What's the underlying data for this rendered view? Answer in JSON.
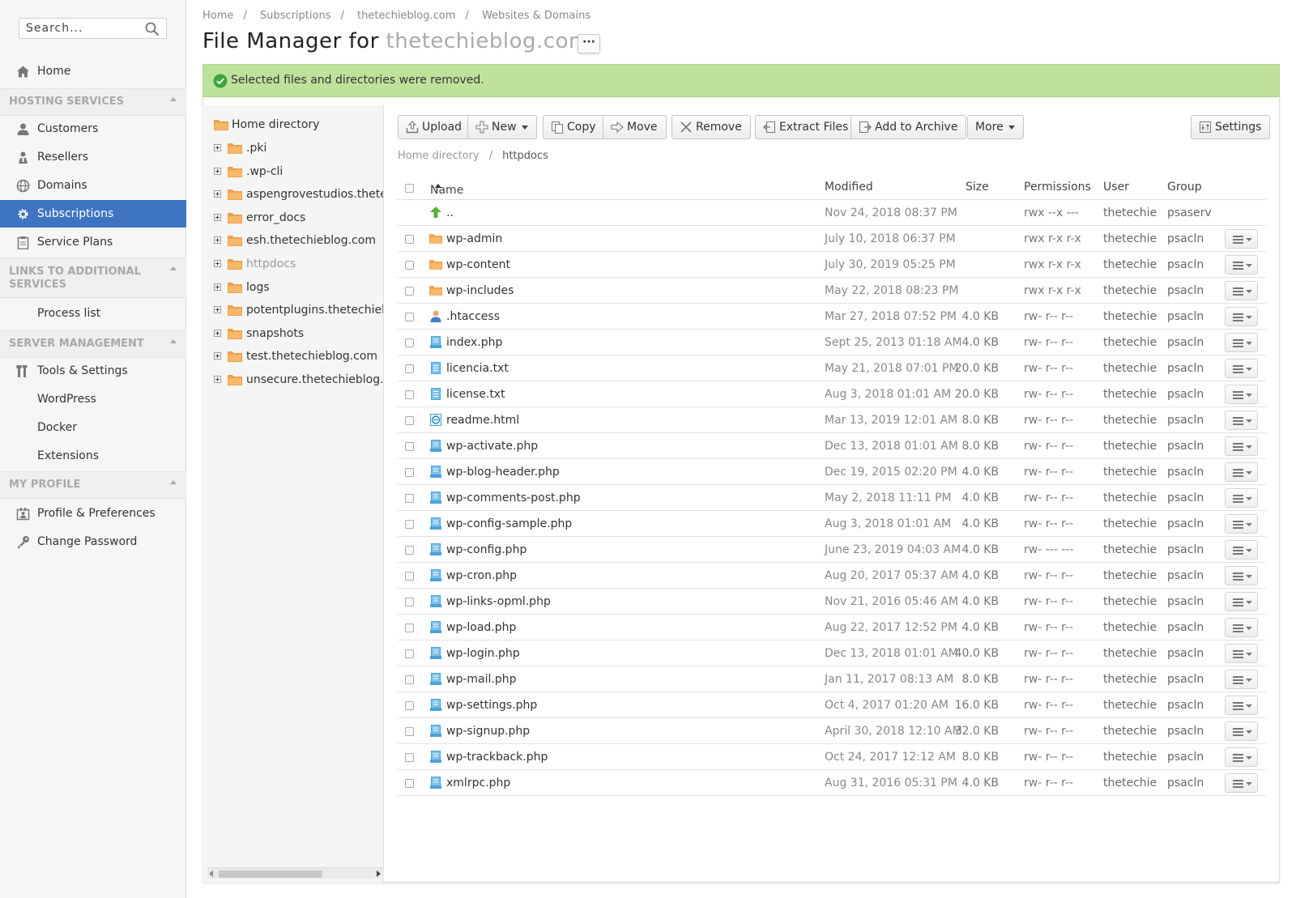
{
  "sidebar": {
    "search": {
      "placeholder": "Search..."
    },
    "home": "Home",
    "sections": [
      {
        "title": "HOSTING SERVICES",
        "items": [
          "Customers",
          "Resellers",
          "Domains",
          "Subscriptions",
          "Service Plans"
        ]
      },
      {
        "title": "LINKS TO ADDITIONAL SERVICES",
        "items": [
          "Process list"
        ]
      },
      {
        "title": "SERVER MANAGEMENT",
        "items": [
          "Tools & Settings",
          "WordPress",
          "Docker",
          "Extensions"
        ]
      },
      {
        "title": "MY PROFILE",
        "items": [
          "Profile & Preferences",
          "Change Password"
        ]
      }
    ],
    "active_item": "Subscriptions",
    "accent_color": "#3f74c2"
  },
  "breadcrumb": [
    "Home",
    "Subscriptions",
    "thetechieblog.com",
    "Websites & Domains"
  ],
  "title": {
    "prefix": "File Manager for",
    "domain": "thetechieblog.com",
    "more_label": "···"
  },
  "alert": {
    "message": "Selected files and directories were removed.",
    "color": "#bfe29a"
  },
  "tree": {
    "root": "Home directory",
    "items": [
      ".pki",
      ".wp-cli",
      "aspengrovestudios.thetechieblog.com",
      "error_docs",
      "esh.thetechieblog.com",
      "httpdocs",
      "logs",
      "potentplugins.thetechieblog.com",
      "snapshots",
      "test.thetechieblog.com",
      "unsecure.thetechieblog.com"
    ],
    "current": "httpdocs"
  },
  "toolbar": {
    "upload": "Upload",
    "new": "New",
    "copy": "Copy",
    "move": "Move",
    "remove": "Remove",
    "extract": "Extract Files",
    "archive": "Add to Archive",
    "more": "More",
    "settings": "Settings"
  },
  "path": {
    "root": "Home directory",
    "current": "httpdocs"
  },
  "table": {
    "columns": {
      "name": "Name",
      "modified": "Modified",
      "size": "Size",
      "permissions": "Permissions",
      "user": "User",
      "group": "Group"
    },
    "rows": [
      {
        "name": "..",
        "type": "up",
        "modified": "Nov 24, 2018 08:37 PM",
        "size": "",
        "perm": "rwx --x ---",
        "user": "thetechie",
        "group": "psaserv"
      },
      {
        "name": "wp-admin",
        "type": "folder",
        "modified": "July 10, 2018 06:37 PM",
        "size": "",
        "perm": "rwx r-x r-x",
        "user": "thetechie",
        "group": "psacln"
      },
      {
        "name": "wp-content",
        "type": "folder",
        "modified": "July 30, 2019 05:25 PM",
        "size": "",
        "perm": "rwx r-x r-x",
        "user": "thetechie",
        "group": "psacln"
      },
      {
        "name": "wp-includes",
        "type": "folder",
        "modified": "May 22, 2018 08:23 PM",
        "size": "",
        "perm": "rwx r-x r-x",
        "user": "thetechie",
        "group": "psacln"
      },
      {
        "name": ".htaccess",
        "type": "user",
        "modified": "Mar 27, 2018 07:52 PM",
        "size": "4.0 KB",
        "perm": "rw- r-- r--",
        "user": "thetechie",
        "group": "psacln"
      },
      {
        "name": "index.php",
        "type": "code",
        "modified": "Sept 25, 2013 01:18 AM",
        "size": "4.0 KB",
        "perm": "rw- r-- r--",
        "user": "thetechie",
        "group": "psacln"
      },
      {
        "name": "licencia.txt",
        "type": "text",
        "modified": "May 21, 2018 07:01 PM",
        "size": "20.0 KB",
        "perm": "rw- r-- r--",
        "user": "thetechie",
        "group": "psacln"
      },
      {
        "name": "license.txt",
        "type": "text",
        "modified": "Aug 3, 2018 01:01 AM",
        "size": "20.0 KB",
        "perm": "rw- r-- r--",
        "user": "thetechie",
        "group": "psacln"
      },
      {
        "name": "readme.html",
        "type": "html",
        "modified": "Mar 13, 2019 12:01 AM",
        "size": "8.0 KB",
        "perm": "rw- r-- r--",
        "user": "thetechie",
        "group": "psacln"
      },
      {
        "name": "wp-activate.php",
        "type": "code",
        "modified": "Dec 13, 2018 01:01 AM",
        "size": "8.0 KB",
        "perm": "rw- r-- r--",
        "user": "thetechie",
        "group": "psacln"
      },
      {
        "name": "wp-blog-header.php",
        "type": "code",
        "modified": "Dec 19, 2015 02:20 PM",
        "size": "4.0 KB",
        "perm": "rw- r-- r--",
        "user": "thetechie",
        "group": "psacln"
      },
      {
        "name": "wp-comments-post.php",
        "type": "code",
        "modified": "May 2, 2018 11:11 PM",
        "size": "4.0 KB",
        "perm": "rw- r-- r--",
        "user": "thetechie",
        "group": "psacln"
      },
      {
        "name": "wp-config-sample.php",
        "type": "code",
        "modified": "Aug 3, 2018 01:01 AM",
        "size": "4.0 KB",
        "perm": "rw- r-- r--",
        "user": "thetechie",
        "group": "psacln"
      },
      {
        "name": "wp-config.php",
        "type": "code",
        "modified": "June 23, 2019 04:03 AM",
        "size": "4.0 KB",
        "perm": "rw- --- ---",
        "user": "thetechie",
        "group": "psacln"
      },
      {
        "name": "wp-cron.php",
        "type": "code",
        "modified": "Aug 20, 2017 05:37 AM",
        "size": "4.0 KB",
        "perm": "rw- r-- r--",
        "user": "thetechie",
        "group": "psacln"
      },
      {
        "name": "wp-links-opml.php",
        "type": "code",
        "modified": "Nov 21, 2016 05:46 AM",
        "size": "4.0 KB",
        "perm": "rw- r-- r--",
        "user": "thetechie",
        "group": "psacln"
      },
      {
        "name": "wp-load.php",
        "type": "code",
        "modified": "Aug 22, 2017 12:52 PM",
        "size": "4.0 KB",
        "perm": "rw- r-- r--",
        "user": "thetechie",
        "group": "psacln"
      },
      {
        "name": "wp-login.php",
        "type": "code",
        "modified": "Dec 13, 2018 01:01 AM",
        "size": "40.0 KB",
        "perm": "rw- r-- r--",
        "user": "thetechie",
        "group": "psacln"
      },
      {
        "name": "wp-mail.php",
        "type": "code",
        "modified": "Jan 11, 2017 08:13 AM",
        "size": "8.0 KB",
        "perm": "rw- r-- r--",
        "user": "thetechie",
        "group": "psacln"
      },
      {
        "name": "wp-settings.php",
        "type": "code",
        "modified": "Oct 4, 2017 01:20 AM",
        "size": "16.0 KB",
        "perm": "rw- r-- r--",
        "user": "thetechie",
        "group": "psacln"
      },
      {
        "name": "wp-signup.php",
        "type": "code",
        "modified": "April 30, 2018 12:10 AM",
        "size": "32.0 KB",
        "perm": "rw- r-- r--",
        "user": "thetechie",
        "group": "psacln"
      },
      {
        "name": "wp-trackback.php",
        "type": "code",
        "modified": "Oct 24, 2017 12:12 AM",
        "size": "8.0 KB",
        "perm": "rw- r-- r--",
        "user": "thetechie",
        "group": "psacln"
      },
      {
        "name": "xmlrpc.php",
        "type": "code",
        "modified": "Aug 31, 2016 05:31 PM",
        "size": "4.0 KB",
        "perm": "rw- r-- r--",
        "user": "thetechie",
        "group": "psacln"
      }
    ]
  }
}
